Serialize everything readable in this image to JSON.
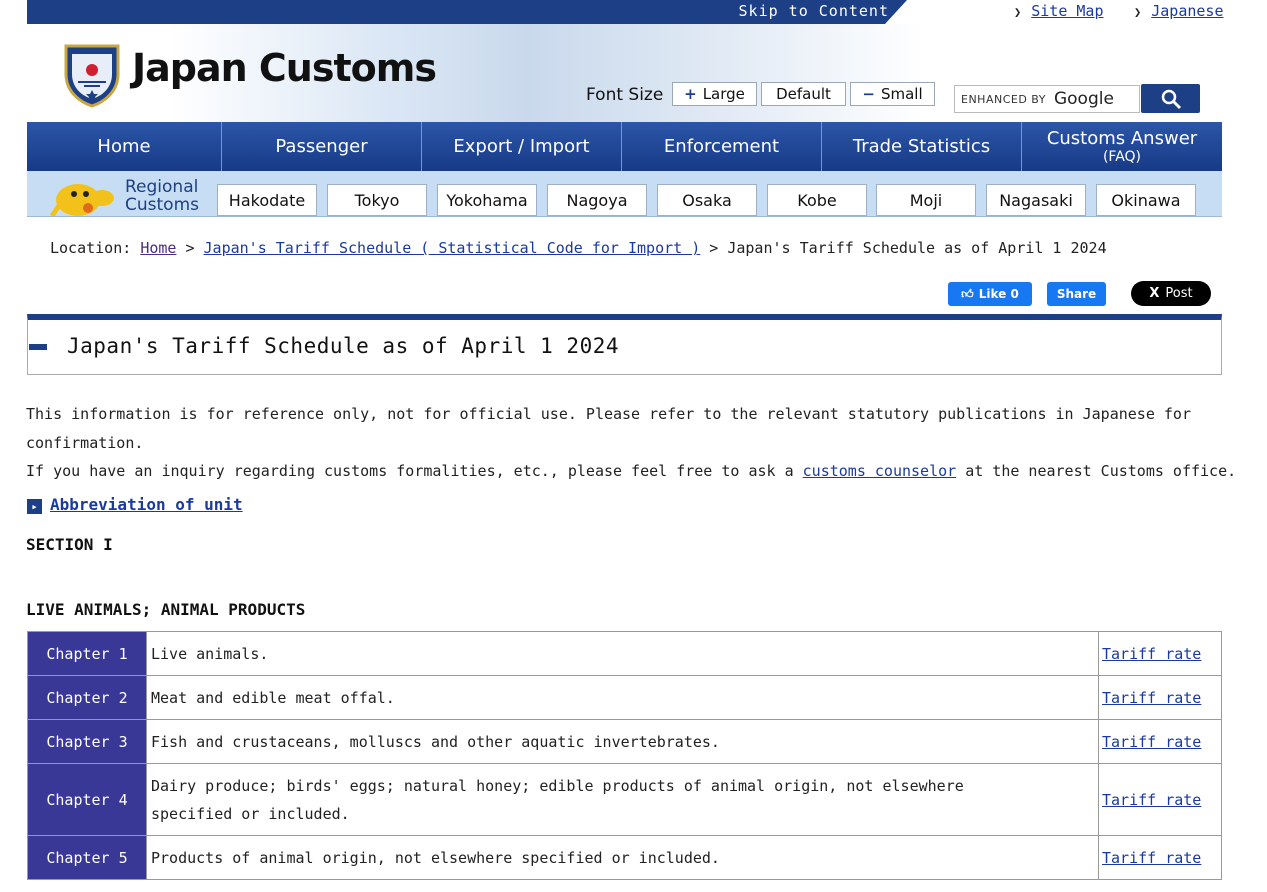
{
  "top_bar": {
    "skip_label": "Skip to Content",
    "sitemap_label": "Site Map",
    "japanese_label": "Japanese"
  },
  "header": {
    "brand": "Japan Customs",
    "font_size": {
      "label": "Font Size",
      "large": "Large",
      "default": "Default",
      "small": "Small"
    },
    "search": {
      "enhanced": "ENHANCED BY",
      "google": "Google"
    }
  },
  "nav": {
    "items": [
      {
        "label": "Home"
      },
      {
        "label": "Passenger"
      },
      {
        "label": "Export / Import"
      },
      {
        "label": "Enforcement"
      },
      {
        "label": "Trade Statistics"
      },
      {
        "label": "Customs Answer",
        "sub": "(FAQ)"
      }
    ]
  },
  "regional": {
    "label_line1": "Regional",
    "label_line2": "Customs",
    "offices": [
      "Hakodate",
      "Tokyo",
      "Yokohama",
      "Nagoya",
      "Osaka",
      "Kobe",
      "Moji",
      "Nagasaki",
      "Okinawa"
    ]
  },
  "breadcrumb": {
    "prefix": "Location:",
    "home": "Home",
    "sep": ">",
    "parent": "Japan's Tariff Schedule ( Statistical Code for Import )",
    "current": "Japan's Tariff Schedule as of April 1 2024"
  },
  "social": {
    "like": "Like 0",
    "share": "Share",
    "post": "Post"
  },
  "page": {
    "title": "Japan's Tariff Schedule as of April 1 2024",
    "notice_line1": "This information is for reference only, not for official use. Please refer to the relevant statutory publications in Japanese for",
    "notice_line2": "confirmation.",
    "inquiry_before": "If you have an inquiry regarding customs formalities, etc., please feel free to ask a ",
    "inquiry_link": "customs counselor",
    "inquiry_after": " at the nearest Customs office.",
    "abbreviation_link": "Abbreviation of unit",
    "section": "SECTION I",
    "section_title": "LIVE ANIMALS; ANIMAL PRODUCTS"
  },
  "chapters": [
    {
      "chapter": "Chapter 1",
      "description": "Live animals.",
      "rate": "Tariff rate"
    },
    {
      "chapter": "Chapter 2",
      "description": "Meat and edible meat offal.",
      "rate": "Tariff rate"
    },
    {
      "chapter": "Chapter 3",
      "description": "Fish and crustaceans, molluscs and other aquatic invertebrates.",
      "rate": "Tariff rate"
    },
    {
      "chapter": "Chapter 4",
      "description": "Dairy produce; birds' eggs; natural honey; edible products of animal origin, not elsewhere specified or included.",
      "rate": "Tariff rate"
    },
    {
      "chapter": "Chapter 5",
      "description": "Products of animal origin, not elsewhere specified or included.",
      "rate": "Tariff rate"
    }
  ]
}
